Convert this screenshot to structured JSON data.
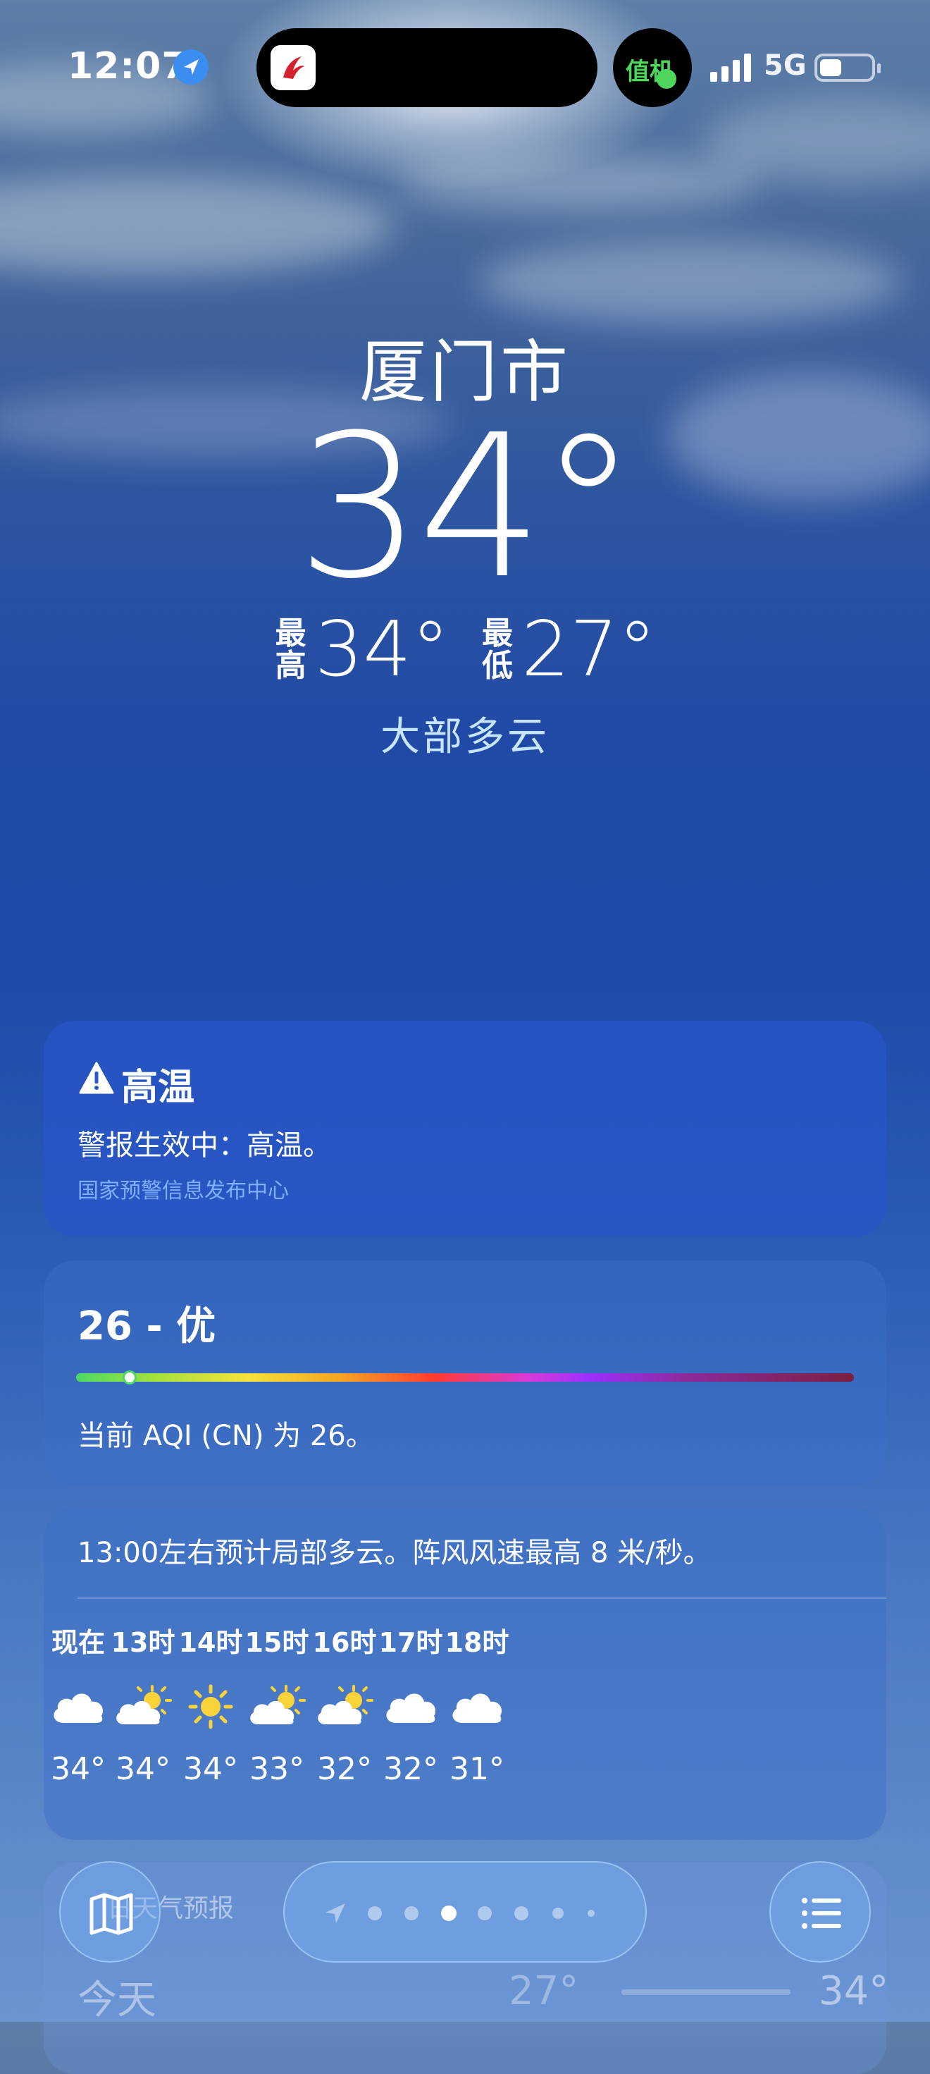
{
  "status_bar": {
    "time": "12:07",
    "island_right_label": "值机",
    "network": "5G"
  },
  "hero": {
    "city": "厦门市",
    "current_temp": "34°",
    "high_label": "最高",
    "high_value": "34°",
    "low_label": "最低",
    "low_value": "27°",
    "condition": "大部多云"
  },
  "alert": {
    "title": "高温",
    "body": "警报生效中：高温。",
    "source": "国家预警信息发布中心"
  },
  "aqi": {
    "value_label": "26 - 优",
    "level_fraction": 0.06,
    "description": "当前 AQI (CN) 为 26。"
  },
  "hourly": {
    "summary": "13:00左右预计局部多云。阵风风速最高 8 米/秒。",
    "hours": [
      {
        "label": "现在",
        "icon": "cloud-icon",
        "temp": "34°"
      },
      {
        "label": "13时",
        "icon": "partly-sunny-icon",
        "temp": "34°"
      },
      {
        "label": "14时",
        "icon": "sun-icon",
        "temp": "34°"
      },
      {
        "label": "15时",
        "icon": "partly-sunny-icon",
        "temp": "33°"
      },
      {
        "label": "16时",
        "icon": "partly-sunny-icon",
        "temp": "32°"
      },
      {
        "label": "17时",
        "icon": "cloud-icon",
        "temp": "32°"
      },
      {
        "label": "18时",
        "icon": "cloud-icon",
        "temp": "31°"
      }
    ]
  },
  "daily": {
    "title": "日天气预报",
    "today_label": "今天",
    "today_low": "27°",
    "today_high": "34°"
  },
  "colors": {
    "accent_blue": "#3b8ef0",
    "condition_text": "#c6e6ff",
    "alert_source": "#7fb0ff",
    "sun": "#f8d43a",
    "island_green": "#4ed65c"
  }
}
